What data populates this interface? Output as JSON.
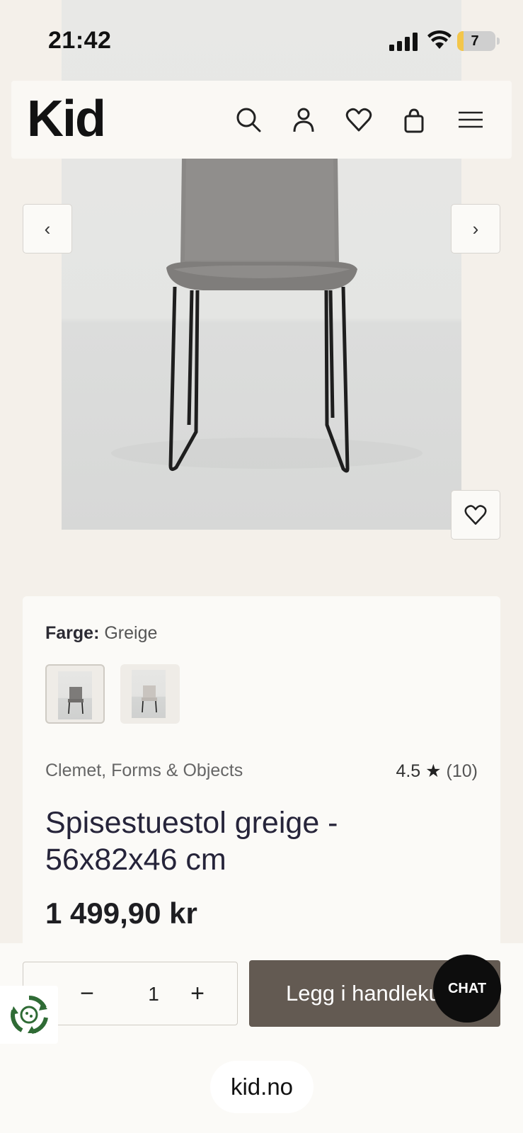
{
  "status_bar": {
    "time": "21:42",
    "battery": "7"
  },
  "header": {
    "logo": "Kid",
    "icons": [
      "search-icon",
      "account-icon",
      "wishlist-icon",
      "cart-icon",
      "menu-icon"
    ]
  },
  "carousel": {
    "prev": "‹",
    "next": "›"
  },
  "product": {
    "color_label": "Farge:",
    "color_value": "Greige",
    "brand": "Clemet, Forms & Objects",
    "rating": "4.5",
    "rating_star": "★",
    "rating_count": "(10)",
    "title": "Spisestuestol greige - 56x82x46 cm",
    "price": "1 499,90 kr"
  },
  "cart": {
    "quantity": "1",
    "minus": "−",
    "plus": "+",
    "add_label": "Legg i handlekurv"
  },
  "chat_label": "CHAT",
  "url": "kid.no",
  "colors": {
    "accent": "#635a52",
    "background": "#f4f0ea",
    "card": "#fbfaf7",
    "battery": "#f3c64a"
  }
}
